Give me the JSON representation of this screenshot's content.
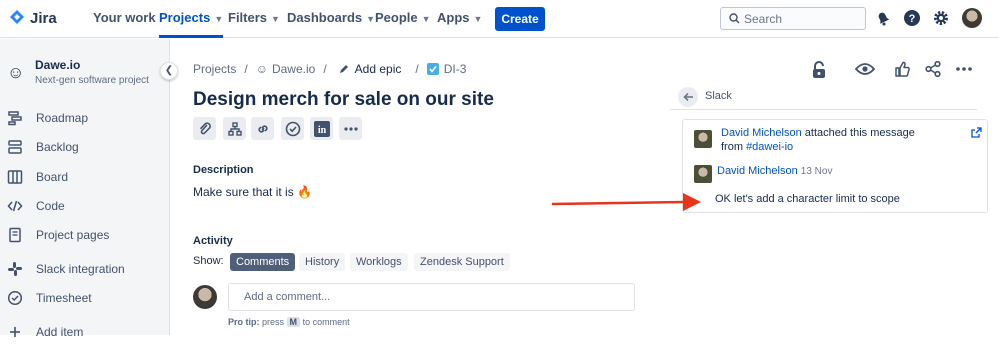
{
  "nav": {
    "logo_text": "Jira",
    "items": [
      {
        "label": "Your work",
        "chevron": false,
        "active": false
      },
      {
        "label": "Projects",
        "chevron": true,
        "active": true
      },
      {
        "label": "Filters",
        "chevron": true,
        "active": false
      },
      {
        "label": "Dashboards",
        "chevron": true,
        "active": false
      },
      {
        "label": "People",
        "chevron": true,
        "active": false
      },
      {
        "label": "Apps",
        "chevron": true,
        "active": false
      }
    ],
    "create_label": "Create",
    "search_placeholder": "Search",
    "accent": "#0052cc"
  },
  "sidebar": {
    "project_name": "Dawe.io",
    "project_type": "Next-gen software project",
    "items": [
      {
        "label": "Roadmap",
        "icon": "roadmap-icon"
      },
      {
        "label": "Backlog",
        "icon": "backlog-icon"
      },
      {
        "label": "Board",
        "icon": "board-icon"
      },
      {
        "label": "Code",
        "icon": "code-icon"
      },
      {
        "label": "Project pages",
        "icon": "pages-icon"
      },
      {
        "label": "Slack integration",
        "icon": "slack-icon"
      },
      {
        "label": "Timesheet",
        "icon": "timesheet-icon"
      },
      {
        "label": "Add item",
        "icon": "add-icon"
      }
    ]
  },
  "breadcrumb": {
    "projects": "Projects",
    "project": "Dawe.io",
    "epic": "Add epic",
    "issue": "DI-3",
    "sep": "/"
  },
  "issue": {
    "title": "Design merch for sale on our site",
    "description_heading": "Description",
    "description": "Make sure that it is",
    "description_emoji": "🔥",
    "activity_heading": "Activity",
    "show_label": "Show:",
    "filters": [
      "Comments",
      "History",
      "Worklogs",
      "Zendesk Support"
    ],
    "selected_filter": "Comments",
    "comment_placeholder": "Add a comment...",
    "protip_label": "Pro tip:",
    "protip_press": "press",
    "protip_key": "M",
    "protip_tail": "to comment"
  },
  "slack": {
    "heading": "Slack",
    "author": "David Michelson",
    "attached_text": "attached this message",
    "from_text": "from",
    "channel": "#dawei-io",
    "message_author": "David Michelson",
    "message_time": "13 Nov",
    "message": "OK let's add a character limit to scope"
  },
  "annotation": {
    "arrow_color": "#e8341c"
  }
}
